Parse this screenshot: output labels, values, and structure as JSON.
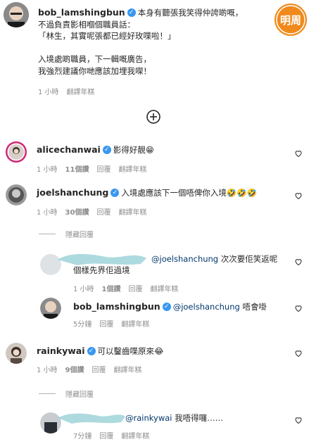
{
  "post_caption": {
    "username": "bob_lamshingbun",
    "lines": [
      "本身有聽張我笑得仲誇啲嘅，",
      "不過負責影相嗰個職員話：",
      "「林生，其實呢張都已經好玫喋啦！」",
      "",
      "入境處啲職員，下一輯嘅廣告，",
      "我強烈建議你哋應該加埋我㗎！"
    ],
    "meta": {
      "time": "1 小時",
      "translate": "翻譯年糕"
    }
  },
  "logo": {
    "text": "明周"
  },
  "comments": [
    {
      "username": "alicechanwai",
      "text": "影得好靚",
      "emoji": "😁",
      "meta": {
        "time": "1 小時",
        "likes": "11個讚",
        "reply": "回覆",
        "translate": "翻譯年糕"
      }
    },
    {
      "username": "joelshanchung",
      "text": "入境處應該下一個唔俾你入境",
      "emoji": "🤣🤣🤣",
      "meta": {
        "time": "1 小時",
        "likes": "30個讚",
        "reply": "回覆",
        "translate": "翻譯年糕"
      },
      "hide_replies": "隱藏回覆",
      "replies": [
        {
          "mention": "@joelshanchung",
          "text": "次次要佢笑返呢",
          "text2": "個樣先界佢過境",
          "meta": {
            "time": "1 小時",
            "likes": "1個讚",
            "reply": "回覆",
            "translate": "翻譯年糕"
          }
        },
        {
          "username": "bob_lamshingbun",
          "mention": "@joelshanchung",
          "text": "唔會啩",
          "meta": {
            "time": "5分鐘",
            "reply": "回覆",
            "translate": "翻譯年糕"
          }
        }
      ]
    },
    {
      "username": "rainkywai",
      "text": "可以鑿齒喋原來",
      "emoji": "😂",
      "meta": {
        "time": "1 小時",
        "likes": "9個讚",
        "reply": "回覆",
        "translate": "翻譯年糕"
      },
      "hide_replies": "隱藏回覆",
      "replies": [
        {
          "mention": "@rainkywai",
          "text": "我唔得囉……",
          "meta": {
            "time": "7分鐘",
            "reply": "回覆",
            "translate": "翻譯年糕"
          }
        }
      ]
    }
  ]
}
